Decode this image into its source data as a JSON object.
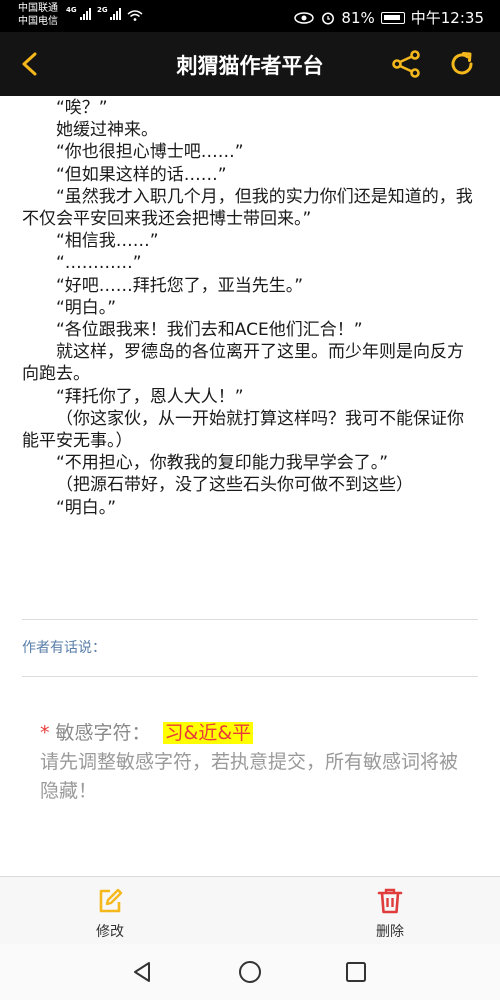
{
  "status": {
    "carrier1": "中国联通",
    "carrier2": "中国电信",
    "sig1_label": "4G",
    "sig2_label": "2G",
    "battery": "81%",
    "time": "中午12:35"
  },
  "appbar": {
    "title": "刺猬猫作者平台",
    "back_icon": "chevron-left-icon",
    "share_icon": "share-icon",
    "refresh_icon": "refresh-icon",
    "accent": "#f5b81c"
  },
  "content": {
    "paragraphs": [
      "“唉？”",
      "她缓过神来。",
      "“你也很担心博士吧……”",
      "“但如果这样的话……”",
      "“虽然我才入职几个月，但我的实力你们还是知道的，我不仅会平安回来我还会把博士带回来。”",
      "“相信我……”",
      "“…………”",
      "“好吧……拜托您了，亚当先生。”",
      "“明白。”",
      "“各位跟我来！我们去和ACE他们汇合！”",
      "就这样，罗德岛的各位离开了这里。而少年则是向反方向跑去。",
      "“拜托你了，恩人大人！”",
      "（你这家伙，从一开始就打算这样吗？我可不能保证你能平安无事。）",
      "“不用担心，你教我的复印能力我早学会了。”",
      "（把源石带好，没了这些石头你可做不到这些）",
      "“明白。”"
    ]
  },
  "author_note": {
    "label": "作者有话说："
  },
  "warning": {
    "star": "*",
    "label": "敏感字符：",
    "words": "习&近&平",
    "message": "请先调整敏感字符，若执意提交，所有敏感词将被隐藏！"
  },
  "actions": {
    "edit_label": "修改",
    "edit_icon": "edit-icon",
    "delete_label": "删除",
    "delete_icon": "trash-icon"
  },
  "nav": {
    "back_icon": "nav-back-icon",
    "home_icon": "nav-home-icon",
    "recents_icon": "nav-recents-icon"
  }
}
